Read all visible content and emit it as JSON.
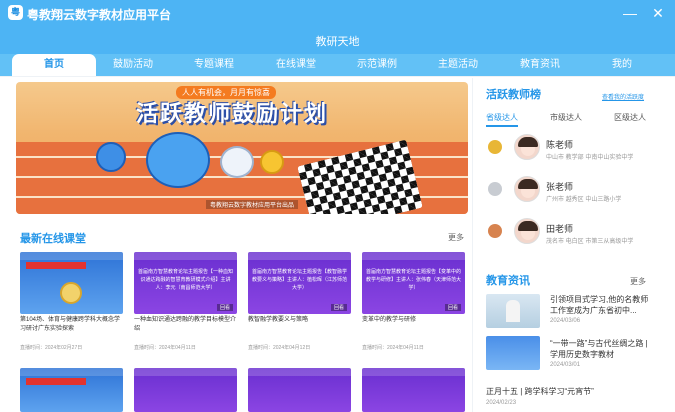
{
  "app": {
    "logo_char": "粤",
    "title": "粤教翔云数字教材应用平台"
  },
  "window": {
    "minimize_glyph": "—",
    "close_glyph": "✕"
  },
  "header": {
    "title": "教研天地"
  },
  "nav": {
    "tabs": [
      "首页",
      "鼓励活动",
      "专题课程",
      "在线课堂",
      "示范课例",
      "主题活动",
      "教育资讯",
      "我的"
    ]
  },
  "banner": {
    "subtitle": "人人有机会，月月有惊喜",
    "headline": "活跃教师鼓励计划",
    "caption": "粤教翔云数字教材应用平台出品"
  },
  "online_classes": {
    "title": "最新在线课堂",
    "more": "更多",
    "items": [
      {
        "thumb_text": "",
        "name": "第104场、体育与健康跨学科大概念学习研讨广东实验探索",
        "date": "直播时间：2024年02月27日"
      },
      {
        "thumb_text": "首届南方智慧教育论坛主题报告【一种血知识通达跨融的智慧育教研模式介绍】主讲人：李元（南昌师范大学）",
        "tag": "回看",
        "name": "一种血知识通达跨融的教学目标模型介绍",
        "date": "直播时间：2024年04月11日"
      },
      {
        "thumb_text": "首届南方智慧教育论坛主题报告【教智融学教要义与策略】主讲人：植松晖（江苏师范大学）",
        "tag": "回看",
        "name": "教智融学教要义与策略",
        "date": "直播时间：2024年04月12日"
      },
      {
        "thumb_text": "首届南方智慧教育论坛主题报告【变革中的教学与研修】主讲人：张伟春（天津师范大学）",
        "tag": "回看",
        "name": "变革中的教学与研修",
        "date": "直播时间：2024年04月11日"
      }
    ]
  },
  "active_teachers": {
    "title": "活跃教师榜",
    "link": "查看我的活跃度",
    "tabs": [
      "省级达人",
      "市级达人",
      "区级达人"
    ],
    "list": [
      {
        "name": "陈老师",
        "info": "中山市  教学部  中南中山实验中学",
        "medal": "#e8b636"
      },
      {
        "name": "张老师",
        "info": "广州市  越秀区  中山三路小学",
        "medal": "#c8ccd2"
      },
      {
        "name": "田老师",
        "info": "茂名市  电白区  市第三从高级中学",
        "medal": "#d7834f"
      }
    ]
  },
  "news": {
    "title": "教育资讯",
    "more": "更多",
    "items": [
      {
        "title": "引领项目式学习,他的名教师工作室成为广东省初中...",
        "date": "2024/03/06"
      },
      {
        "title": "“一带一路”与古代丝绸之路 | 学用历史数字教材",
        "date": "2024/03/01"
      },
      {
        "title": "正月十五 | 跨学科学习“元宵节”",
        "date": "2024/02/23"
      }
    ]
  },
  "colors": {
    "accent": "#2596e8",
    "titlebar": "#4db4f4",
    "navbar": "#62c1f6"
  }
}
